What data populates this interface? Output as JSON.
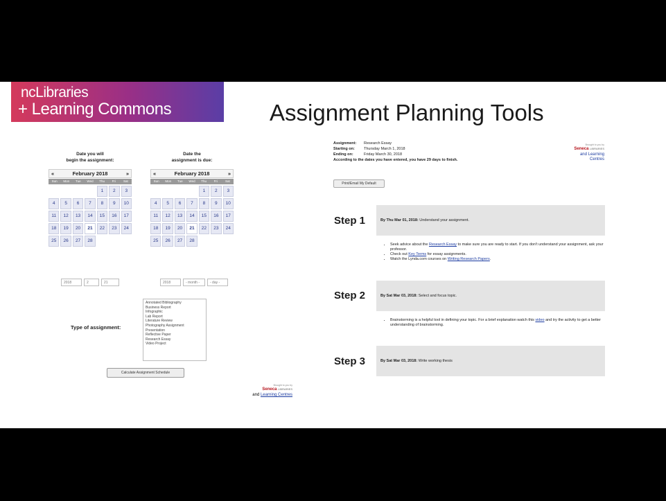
{
  "header": {
    "logo_line1": "ncLibraries",
    "logo_line2": "+ Learning Commons",
    "title": "Assignment Planning Tools"
  },
  "calendars": [
    {
      "caption_line1": "Date you will",
      "caption_line2": "begin the assignment:",
      "prev": "«",
      "month": "February 2018",
      "next": "»",
      "dow": [
        "Sun",
        "Mon",
        "Tue",
        "Wed",
        "Thu",
        "Fri",
        "Sat"
      ],
      "days": [
        "",
        "",
        "",
        "",
        "1",
        "2",
        "3",
        "4",
        "5",
        "6",
        "7",
        "8",
        "9",
        "10",
        "11",
        "12",
        "13",
        "14",
        "15",
        "16",
        "17",
        "18",
        "19",
        "20",
        "21",
        "22",
        "23",
        "24",
        "25",
        "26",
        "27",
        "28"
      ],
      "today": "21"
    },
    {
      "caption_line1": "Date the",
      "caption_line2": "assignment is due:",
      "prev": "«",
      "month": "February 2018",
      "next": "»",
      "dow": [
        "Sun",
        "Mon",
        "Tue",
        "Wed",
        "Thu",
        "Fri",
        "Sat"
      ],
      "days": [
        "",
        "",
        "",
        "",
        "1",
        "2",
        "3",
        "4",
        "5",
        "6",
        "7",
        "8",
        "9",
        "10",
        "11",
        "12",
        "13",
        "14",
        "15",
        "16",
        "17",
        "18",
        "19",
        "20",
        "21",
        "22",
        "23",
        "24",
        "25",
        "26",
        "27",
        "28"
      ],
      "today": "21"
    }
  ],
  "date_selects": {
    "start_year": "2018",
    "start_month": "2",
    "start_day": "21",
    "due_year": "2018",
    "due_month": "- month -",
    "due_day": "- day -"
  },
  "type_label": "Type of assignment:",
  "assignment_types": [
    "Annotated Bibliography",
    "Business Report",
    "Infographic",
    "Lab Report",
    "Literature Review",
    "Photography Assignment",
    "Presentation",
    "Reflective Paper",
    "Research Essay",
    "Video Project"
  ],
  "calculate_button": "Calculate Assignment Schedule",
  "seneca": {
    "tag": "Brought to you by",
    "name": "Seneca",
    "libraries": "LIBRARIES",
    "and": "and",
    "lc": "Learning Centres"
  },
  "summary": {
    "assignment_label": "Assignment:",
    "assignment_value": "Research Essay",
    "start_label": "Starting on:",
    "start_value": "Thursday March 1, 2018",
    "end_label": "Ending on:",
    "end_value": "Friday March 30, 2018",
    "according": "According to the dates you have entered, you have 29 days to finish.",
    "print_button": "Print/Email My Default"
  },
  "steps": [
    {
      "label": "Step 1",
      "date": "By Thu Mar 01, 2018:",
      "task": "Understand your assignment.",
      "bullets": [
        {
          "pre": "Seek advice about the ",
          "link": "Research Essay",
          "post": " to make sure you are ready to start. If you don't understand your assignment, ask your professor."
        },
        {
          "pre": "Check out ",
          "link": "Key Terms",
          "post": " for essay assignments."
        },
        {
          "pre": "Watch the Lynda.com courses on ",
          "link": "Writing Research Papers",
          "post": "."
        }
      ]
    },
    {
      "label": "Step 2",
      "date": "By Sat Mar 03, 2018:",
      "task": "Select and focus topic.",
      "bullets": [
        {
          "pre": "Brainstorming is a helpful tool in defining your topic. For a brief explanation watch this ",
          "link": "video",
          "post": " and try the activity to get a better understanding of brainstorming."
        }
      ]
    },
    {
      "label": "Step 3",
      "date": "By Sat Mar 03, 2018:",
      "task": "Write working thesis",
      "bullets": []
    }
  ],
  "colors": {
    "seneca_red": "#b5121b",
    "link": "#1a3aa0",
    "step_bg": "#e4e4e4"
  }
}
